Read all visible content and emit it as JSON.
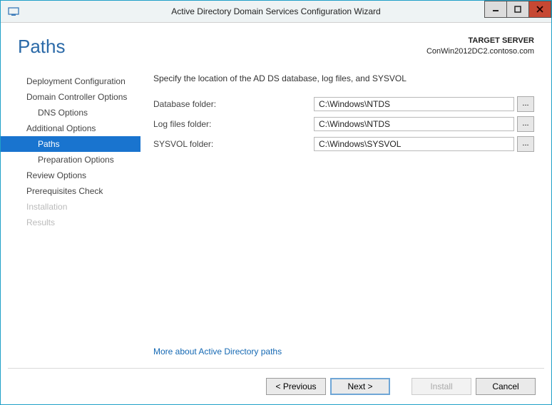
{
  "window": {
    "title": "Active Directory Domain Services Configuration Wizard"
  },
  "header": {
    "page_title": "Paths",
    "target_label": "TARGET SERVER",
    "target_server": "ConWin2012DC2.contoso.com"
  },
  "sidebar": {
    "items": [
      {
        "label": "Deployment Configuration",
        "sub": false,
        "selected": false,
        "disabled": false
      },
      {
        "label": "Domain Controller Options",
        "sub": false,
        "selected": false,
        "disabled": false
      },
      {
        "label": "DNS Options",
        "sub": true,
        "selected": false,
        "disabled": false
      },
      {
        "label": "Additional Options",
        "sub": false,
        "selected": false,
        "disabled": false
      },
      {
        "label": "Paths",
        "sub": true,
        "selected": true,
        "disabled": false
      },
      {
        "label": "Preparation Options",
        "sub": true,
        "selected": false,
        "disabled": false
      },
      {
        "label": "Review Options",
        "sub": false,
        "selected": false,
        "disabled": false
      },
      {
        "label": "Prerequisites Check",
        "sub": false,
        "selected": false,
        "disabled": false
      },
      {
        "label": "Installation",
        "sub": false,
        "selected": false,
        "disabled": true
      },
      {
        "label": "Results",
        "sub": false,
        "selected": false,
        "disabled": true
      }
    ]
  },
  "content": {
    "instruction": "Specify the location of the AD DS database, log files, and SYSVOL",
    "fields": {
      "database": {
        "label": "Database folder:",
        "value": "C:\\Windows\\NTDS"
      },
      "logfiles": {
        "label": "Log files folder:",
        "value": "C:\\Windows\\NTDS"
      },
      "sysvol": {
        "label": "SYSVOL folder:",
        "value": "C:\\Windows\\SYSVOL"
      }
    },
    "browse_label": "...",
    "more_link": "More about Active Directory paths"
  },
  "footer": {
    "previous": "< Previous",
    "next": "Next >",
    "install": "Install",
    "cancel": "Cancel"
  }
}
